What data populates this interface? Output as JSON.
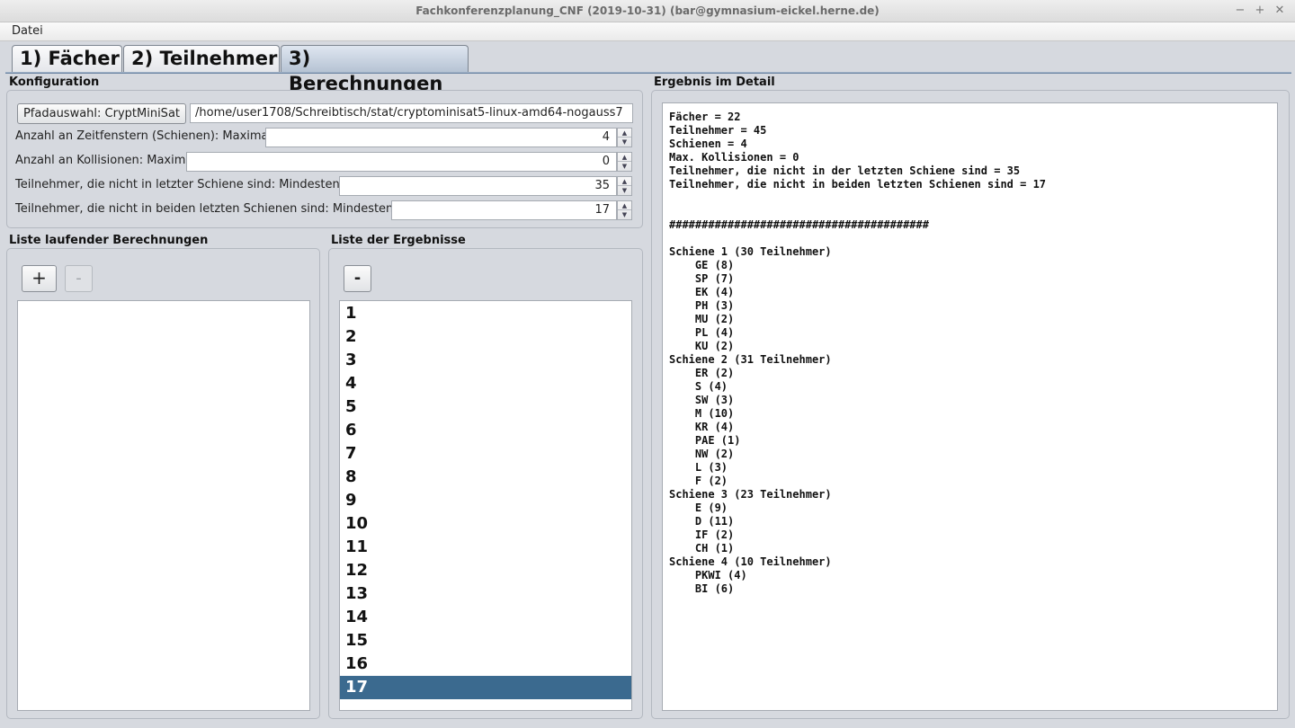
{
  "window": {
    "title": "Fachkonferenzplanung_CNF (2019-10-31) (bar@gymnasium-eickel.herne.de)",
    "minimize_glyph": "−",
    "maximize_glyph": "+",
    "close_glyph": "✕"
  },
  "menu": {
    "file_label": "Datei"
  },
  "tabs": [
    {
      "label": "1) Fächer"
    },
    {
      "label": "2) Teilnehmer"
    },
    {
      "label": "3) Berechnungen"
    }
  ],
  "config": {
    "title": "Konfiguration",
    "path_button": "Pfadauswahl: CryptMiniSat",
    "path_value": "/home/user1708/Schreibtisch/stat/cryptominisat5-linux-amd64-nogauss7",
    "rows": [
      {
        "label": "Anzahl an Zeitfenstern (Schienen): Maximal",
        "value": "4"
      },
      {
        "label": "Anzahl an Kollisionen: Maximal",
        "value": "0"
      },
      {
        "label": "Teilnehmer, die nicht in letzter Schiene sind: Mindestens",
        "value": "35"
      },
      {
        "label": "Teilnehmer, die nicht in beiden letzten Schienen sind: Mindestens",
        "value": "17"
      }
    ]
  },
  "running": {
    "title": "Liste laufender Berechnungen",
    "add_label": "+",
    "remove_label": "-"
  },
  "results": {
    "title": "Liste der Ergebnisse",
    "remove_label": "-",
    "items": [
      "1",
      "2",
      "3",
      "4",
      "5",
      "6",
      "7",
      "8",
      "9",
      "10",
      "11",
      "12",
      "13",
      "14",
      "15",
      "16",
      "17"
    ],
    "selected": "17"
  },
  "detail": {
    "title": "Ergebnis im Detail",
    "text": "Fächer = 22\nTeilnehmer = 45\nSchienen = 4\nMax. Kollisionen = 0\nTeilnehmer, die nicht in der letzten Schiene sind = 35\nTeilnehmer, die nicht in beiden letzten Schienen sind = 17\n\n\n########################################\n\nSchiene 1 (30 Teilnehmer)\n    GE (8)\n    SP (7)\n    EK (4)\n    PH (3)\n    MU (2)\n    PL (4)\n    KU (2)\nSchiene 2 (31 Teilnehmer)\n    ER (2)\n    S (4)\n    SW (3)\n    M (10)\n    KR (4)\n    PAE (1)\n    NW (2)\n    L (3)\n    F (2)\nSchiene 3 (23 Teilnehmer)\n    E (9)\n    D (11)\n    IF (2)\n    CH (1)\nSchiene 4 (10 Teilnehmer)\n    PKWI (4)\n    BI (6)"
  }
}
